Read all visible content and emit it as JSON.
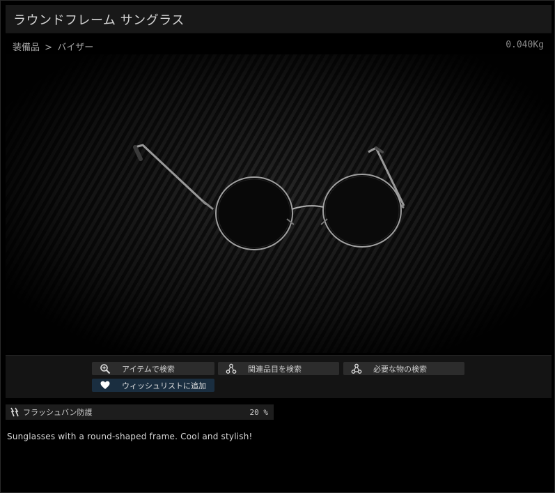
{
  "window": {
    "title": "ラウンドフレーム サングラス"
  },
  "breadcrumb": {
    "category": "装備品",
    "separator": ">",
    "subcategory": "バイザー"
  },
  "item": {
    "weight": "0.040Kg",
    "description": "Sunglasses with a round-shaped frame. Cool and stylish!"
  },
  "actions": {
    "search_item": {
      "label": "アイテムで検索",
      "icon": "magnifier-plus-icon"
    },
    "search_related": {
      "label": "関連品目を検索",
      "icon": "nodes-icon"
    },
    "search_required": {
      "label": "必要な物の検索",
      "icon": "nodes-icon"
    },
    "wishlist": {
      "label": "ウィッシュリストに追加",
      "icon": "heart-icon",
      "color": "#1a2e40"
    }
  },
  "stats": [
    {
      "label": "フラッシュバン防護",
      "value": "20 %",
      "icon": "flashbang-icon"
    }
  ]
}
